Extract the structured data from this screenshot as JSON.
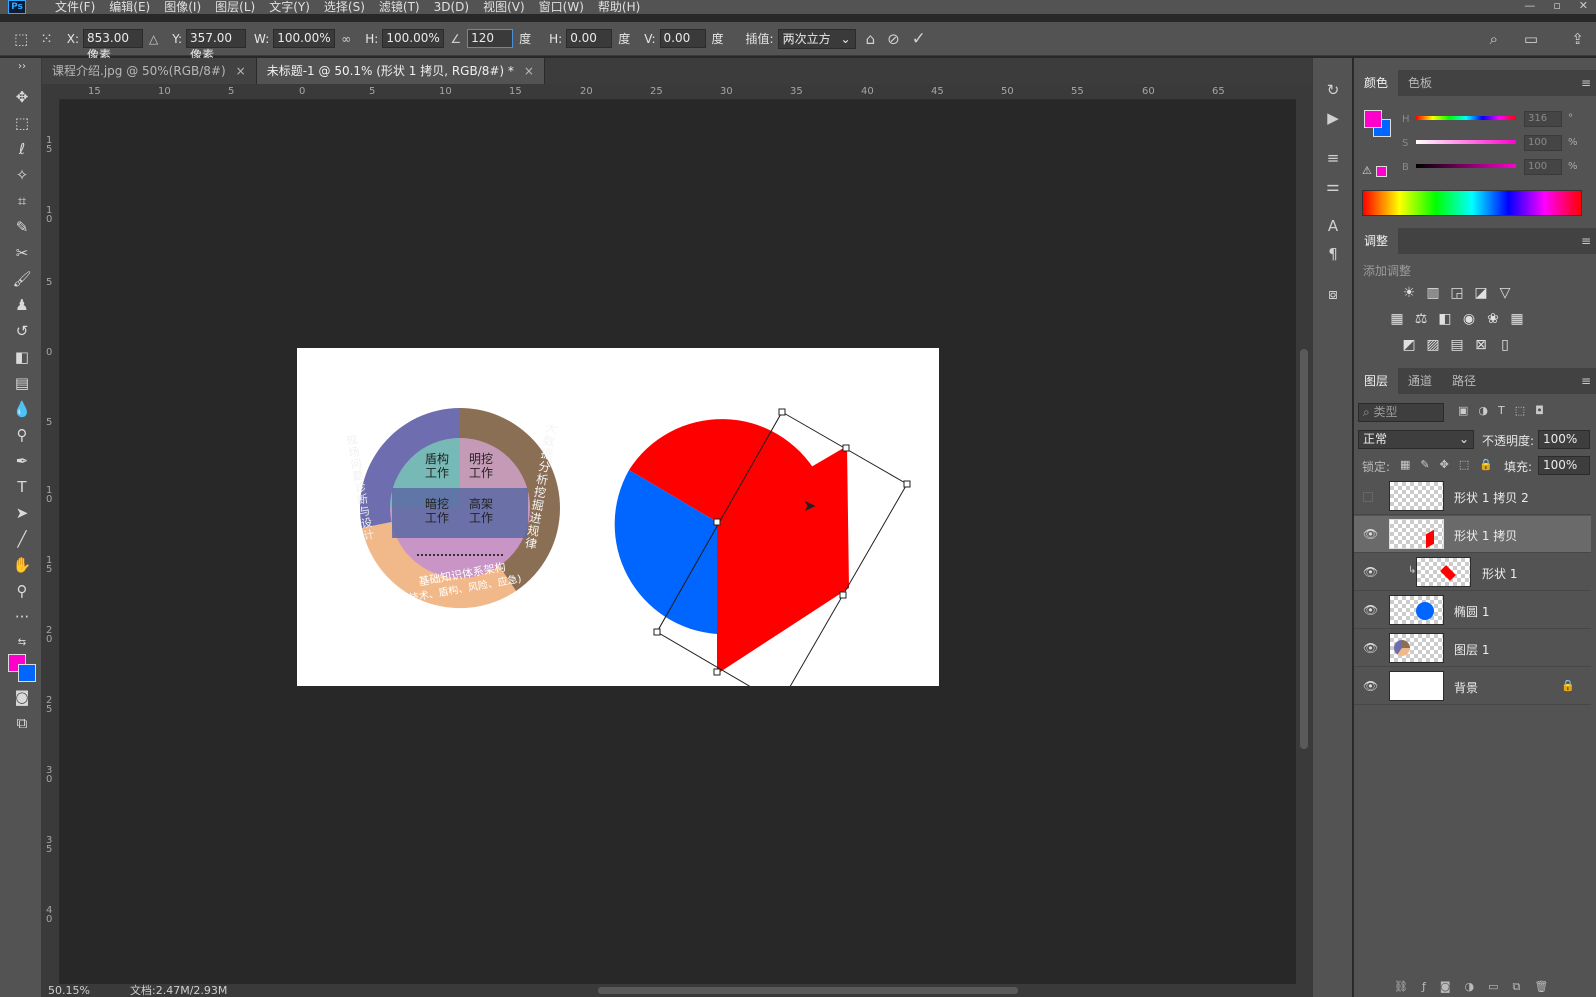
{
  "app": {
    "logo": "Ps"
  },
  "menu": [
    "文件(F)",
    "编辑(E)",
    "图像(I)",
    "图层(L)",
    "文字(Y)",
    "选择(S)",
    "滤镜(T)",
    "3D(D)",
    "视图(V)",
    "窗口(W)",
    "帮助(H)"
  ],
  "window_controls": [
    "—",
    "▫",
    "✕"
  ],
  "options": {
    "x_label": "X:",
    "x_value": "853.00 像素",
    "y_label": "Y:",
    "y_value": "357.00 像素",
    "w_label": "W:",
    "w_value": "100.00%",
    "h_label": "H:",
    "h_value": "100.00%",
    "angle_value": "120",
    "angle_unit": "度",
    "hskew_label": "H:",
    "hskew_value": "0.00",
    "hskew_unit": "度",
    "vskew_label": "V:",
    "vskew_value": "0.00",
    "vskew_unit": "度",
    "interp_label": "插值:",
    "interp_value": "两次立方"
  },
  "tabs": [
    {
      "label": "课程介绍.jpg @ 50%(RGB/8#)",
      "close": "×"
    },
    {
      "label": "未标题-1 @ 50.1% (形状 1 拷贝, RGB/8#) *",
      "close": "×"
    }
  ],
  "ruler_top": [
    "15",
    "10",
    "5",
    "0",
    "5",
    "10",
    "15",
    "20",
    "25",
    "30",
    "35",
    "40",
    "45",
    "50",
    "55",
    "60",
    "65"
  ],
  "ruler_left": [
    "1 5",
    "1 0",
    "5",
    "0",
    "5",
    "1 0",
    "1 5",
    "2 0",
    "2 5",
    "3 0",
    "3 5",
    "4 0"
  ],
  "status": {
    "zoom": "50.15%",
    "doc": "文档:2.47M/2.93M"
  },
  "artwork": {
    "segments": [
      "盾构\n工作",
      "明挖\n工作",
      "暗挖\n工作",
      "高架\n工作"
    ],
    "ring_left": "现场问题诊断与设计",
    "ring_right": "大数据分析挖掘进规律",
    "ring_bottom": "基础知识体系架构",
    "ring_bottom_sub": "(技术、盾构、风险、应急)"
  },
  "color_panel": {
    "tabs": [
      "颜色",
      "色板"
    ],
    "h_label": "H",
    "h_value": "316",
    "h_unit": "°",
    "s_label": "S",
    "s_value": "100",
    "s_unit": "%",
    "b_label": "B",
    "b_value": "100",
    "b_unit": "%",
    "fg_color": "#ff00cc",
    "bg_color": "#0066ff"
  },
  "adjust_panel": {
    "tab": "调整",
    "subtitle": "添加调整"
  },
  "layers_panel": {
    "tabs": [
      "图层",
      "通道",
      "路径"
    ],
    "filter_placeholder": "类型",
    "blend_mode": "正常",
    "opacity_label": "不透明度:",
    "opacity_value": "100%",
    "lock_label": "锁定:",
    "fill_label": "填充:",
    "fill_value": "100%",
    "layers": [
      {
        "name": "形状 1 拷贝 2",
        "visible": false
      },
      {
        "name": "形状 1 拷贝",
        "visible": true
      },
      {
        "name": "形状 1",
        "visible": true
      },
      {
        "name": "椭圆 1",
        "visible": true
      },
      {
        "name": "图层 1",
        "visible": true
      },
      {
        "name": "背景",
        "visible": true
      }
    ]
  }
}
